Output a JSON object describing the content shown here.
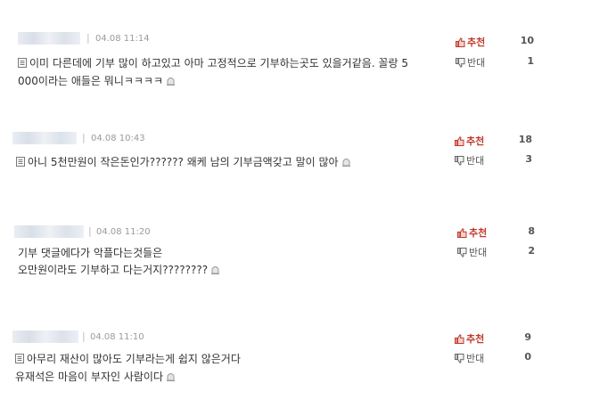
{
  "comments": [
    {
      "date": "04.08 11:14",
      "lines": [
        "이미 다른데에 기부 많이 하고있고 아마 고정적으로 기부하는곳도 있을거같음. 꼴랑 5",
        "000이라는 애들은 뭐니ㅋㅋㅋㅋ"
      ],
      "recommend_label": "추천",
      "oppose_label": "반대",
      "recommend_count": "10",
      "oppose_count": "1"
    },
    {
      "date": "04.08 10:43",
      "lines": [
        "아니 5천만원이 작은돈인가?????? 왜케 남의 기부금액갖고 말이 많아"
      ],
      "recommend_label": "추천",
      "oppose_label": "반대",
      "recommend_count": "18",
      "oppose_count": "3"
    },
    {
      "date": "04.08 11:20",
      "lines": [
        "기부 댓글에다가 악플다는것들은",
        "오만원이라도 기부하고 다는거지????????"
      ],
      "recommend_label": "추천",
      "oppose_label": "반대",
      "recommend_count": "8",
      "oppose_count": "2"
    },
    {
      "date": "04.08 11:10",
      "lines": [
        "아무리 재산이 많아도 기부라는게 쉽지 않은거다",
        "유재석은 마음이 부자인 사람이다"
      ],
      "recommend_label": "추천",
      "oppose_label": "반대",
      "recommend_count": "9",
      "oppose_count": "0"
    }
  ],
  "separator": "|",
  "colors": {
    "recommend": "#c0392b",
    "oppose": "#555555",
    "date": "#9a9a9a"
  },
  "icons": {
    "doc": "document-icon",
    "report": "report-icon",
    "recommend": "thumbs-up-icon",
    "oppose": "thumbs-down-icon"
  }
}
